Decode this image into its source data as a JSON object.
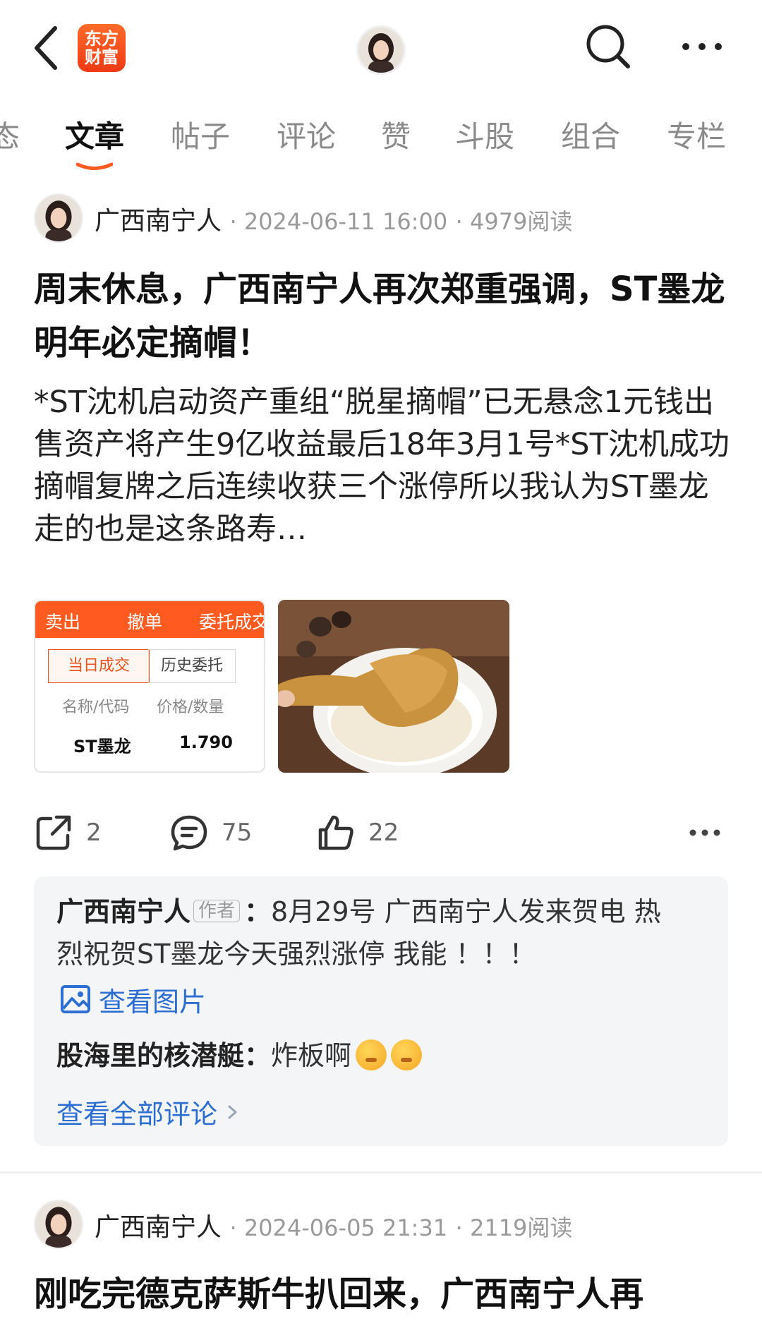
{
  "header": {
    "logo_text": "东方财富",
    "back_icon": "chevron-left-icon",
    "search_icon": "search-icon",
    "more_icon": "more-horizontal-icon"
  },
  "tabs": [
    {
      "label": "态",
      "active": false
    },
    {
      "label": "文章",
      "active": true
    },
    {
      "label": "帖子",
      "active": false
    },
    {
      "label": "评论",
      "active": false
    },
    {
      "label": "赞",
      "active": false
    },
    {
      "label": "斗股",
      "active": false
    },
    {
      "label": "组合",
      "active": false
    },
    {
      "label": "专栏",
      "active": false
    }
  ],
  "posts": [
    {
      "author": "广西南宁人",
      "date": "2024-06-11 16:00",
      "reads": "4979阅读",
      "title": "周末休息，广西南宁人再次郑重强调，ST墨龙明年必定摘帽！",
      "body": "*ST沈机启动资产重组“脱星摘帽”已无悬念1元钱出售资产将产生9亿收益最后18年3月1号*ST沈机成功摘帽复牌之后连续收获三个涨停所以我认为ST墨龙走的也是这条路寿…",
      "thumb1": {
        "header_tabs": [
          "卖出",
          "撤单",
          "委托成交"
        ],
        "sub_tabs": [
          "当日成交",
          "历史委托"
        ],
        "col_name": "名称/代码",
        "col_price": "价格/数量",
        "stock_name": "ST墨龙",
        "stock_price": "1.790"
      },
      "actions": {
        "share": "2",
        "comments": "75",
        "likes": "22"
      },
      "comments": [
        {
          "name": "广西南宁人",
          "tag": "作者",
          "text": "8月29号  广西南宁人发来贺电  热烈祝贺ST墨龙今天强烈涨停  我能 ！！！",
          "image_link": "查看图片"
        },
        {
          "name": "股海里的核潜艇",
          "text": "炸板啊"
        }
      ],
      "view_all": "查看全部评论"
    },
    {
      "author": "广西南宁人",
      "date": "2024-06-05 21:31",
      "reads": "2119阅读",
      "title": "刚吃完德克萨斯牛扒回来，广西南宁人再"
    }
  ],
  "colors": {
    "accent": "#ff5a1f",
    "link": "#2c6fd0"
  }
}
